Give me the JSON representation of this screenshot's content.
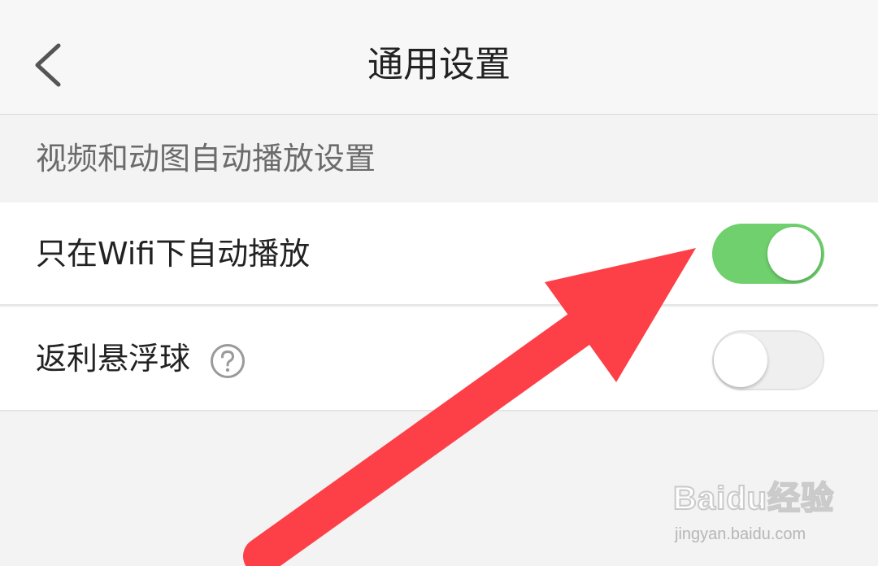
{
  "header": {
    "title": "通用设置",
    "back_icon": "chevron-left-icon"
  },
  "section": {
    "label": "视频和动图自动播放设置"
  },
  "settings": [
    {
      "label": "只在Wifi下自动播放",
      "enabled": true,
      "toggle_color": "#6fd06d"
    },
    {
      "label": "返利悬浮球",
      "enabled": false,
      "help_icon": "question-circle-icon"
    }
  ],
  "annotation": {
    "arrow_color": "#fd3f47"
  },
  "watermark": {
    "logo_text": "Baidu经验",
    "url": "jingyan.baidu.com"
  }
}
